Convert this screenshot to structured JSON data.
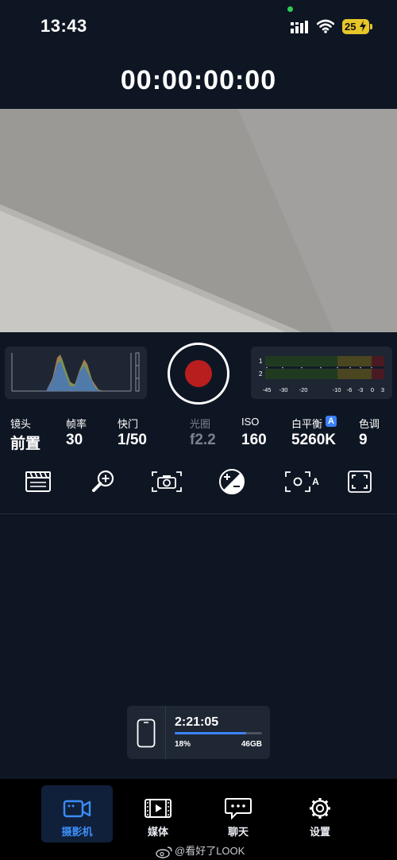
{
  "status": {
    "time": "13:43",
    "battery": "25"
  },
  "timecode": "00:00:00:00",
  "meter": {
    "channels": [
      "1",
      "2"
    ],
    "scale": [
      "-45",
      "-30",
      "-20",
      "-10",
      "-6",
      "-3",
      "0",
      "3"
    ]
  },
  "params": [
    {
      "label": "镜头",
      "value": "前置"
    },
    {
      "label": "帧率",
      "value": "30"
    },
    {
      "label": "快门",
      "value": "1/50"
    },
    {
      "label": "光圈",
      "value": "f2.2"
    },
    {
      "label": "ISO",
      "value": "160"
    },
    {
      "label": "白平衡",
      "value": "5260K",
      "badge": "A"
    },
    {
      "label": "色调",
      "value": "9"
    }
  ],
  "tools": {
    "stabilizer_badge": "A",
    "icons": [
      "clapper-icon",
      "zoom-in-icon",
      "focus-camera-icon",
      "exposure-compensation-icon",
      "auto-stabilization-icon",
      "frame-guides-icon"
    ]
  },
  "storage": {
    "remaining": "2:21:05",
    "percent": "18%",
    "free": "46GB",
    "used_fraction": 0.82
  },
  "tabs": [
    {
      "label": "摄影机",
      "active": true
    },
    {
      "label": "媒体",
      "active": false
    },
    {
      "label": "聊天",
      "active": false
    },
    {
      "label": "设置",
      "active": false
    }
  ],
  "watermark": "@看好了LOOK",
  "colors": {
    "accent": "#3b82f6",
    "record": "#b81e1e",
    "background": "#0f1623"
  }
}
